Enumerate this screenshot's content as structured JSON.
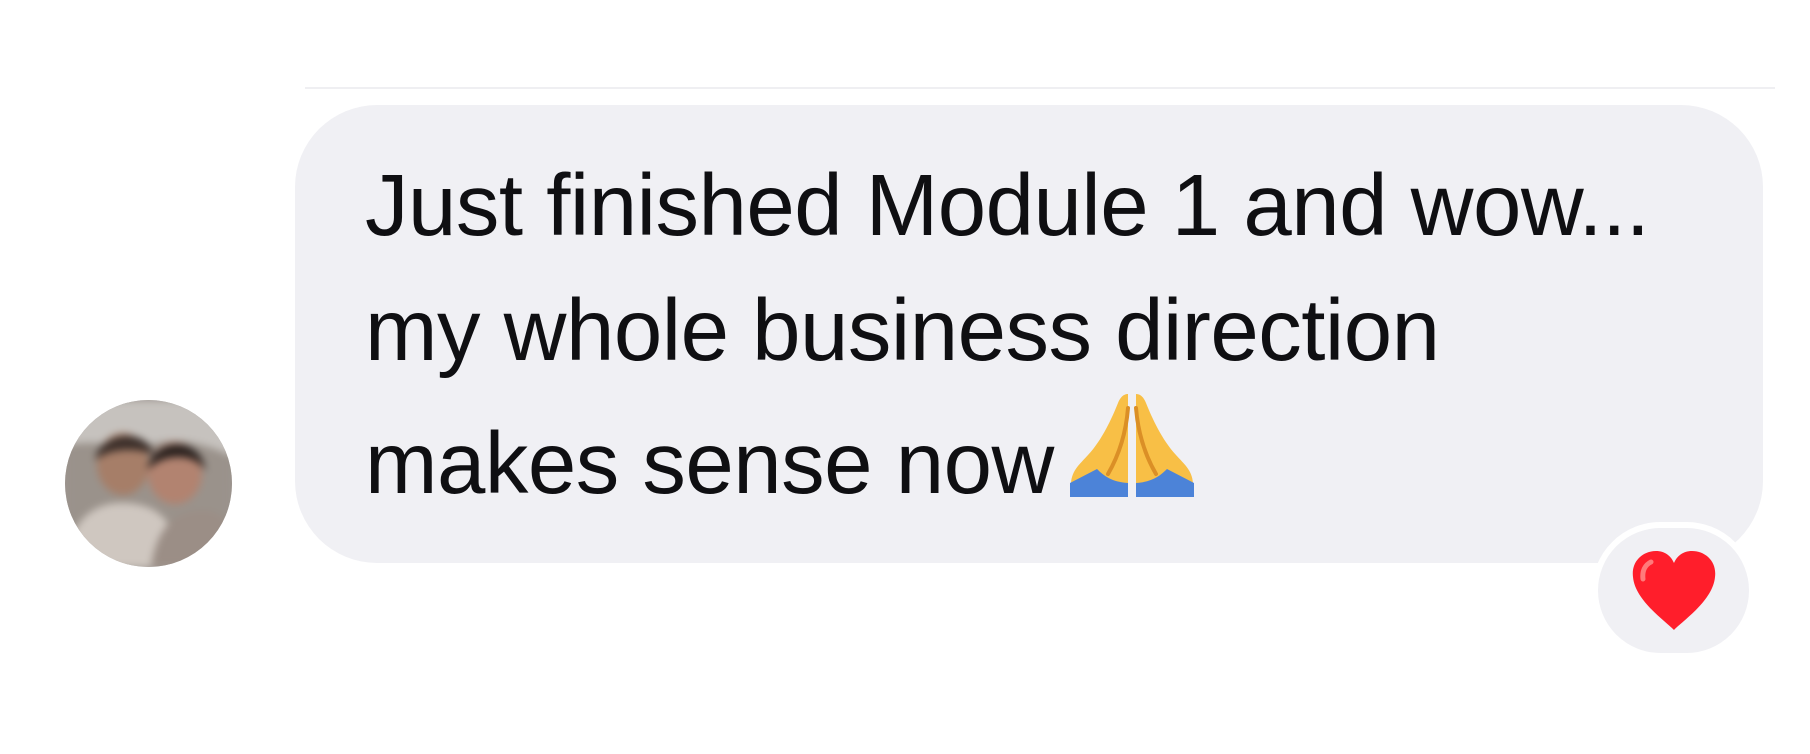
{
  "message": {
    "text": "Just finished Module 1 and wow... my whole business direction makes sense now",
    "inline_emoji": "folded-hands-icon",
    "reaction": "red-heart-icon",
    "bubble_color": "#f0f0f4",
    "text_color": "#0f0f12"
  },
  "avatar": {
    "image": "blurred-profile-photo",
    "description": "Blurred photo of two people"
  },
  "colors": {
    "background": "#ffffff",
    "bubble": "#f0f0f4",
    "heart": "#ff1e2b"
  }
}
